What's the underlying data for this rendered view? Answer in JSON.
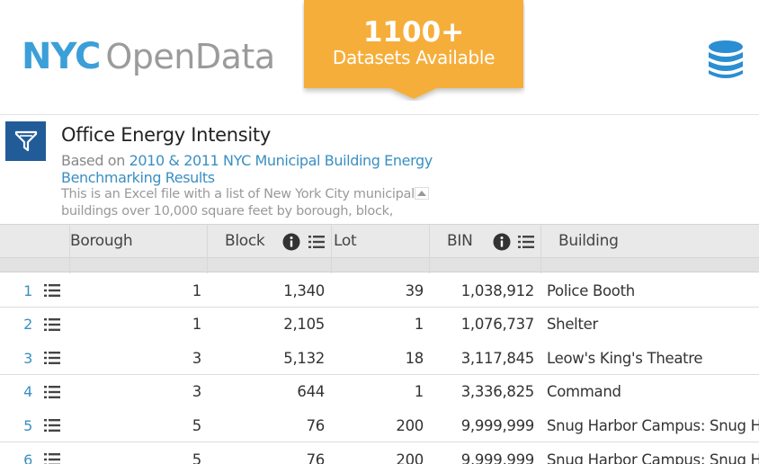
{
  "header": {
    "logo_nyc": "NYC",
    "logo_open": "OpenData",
    "banner_count": "1100+",
    "banner_sub": "Datasets Available",
    "colors": {
      "logo_blue": "#3b9fd8",
      "logo_grey": "#9b9b9b",
      "banner": "#f6ae3b",
      "db_icon": "#2a8ed3"
    },
    "right_icon": "database-icon"
  },
  "dataset": {
    "filter_icon": "filter-icon",
    "title": "Office Energy Intensity",
    "based_prefix": "Based on ",
    "based_link": "2010 & 2011 NYC Municipal Building Energy Benchmarking Results",
    "description": "This is an Excel file with a list of New York City municipal buildings over 10,000 square feet by borough, block, lot,",
    "collapse_icon": "collapse-up-icon"
  },
  "table": {
    "columns": [
      "Borough",
      "Block",
      "Lot",
      "BIN",
      "Building"
    ],
    "header_icons": [
      "info-icon",
      "list-icon"
    ],
    "rows": [
      {
        "index": "1",
        "borough": "1",
        "block": "1,340",
        "lot": "39",
        "bin": "1,038,912",
        "building": "Police Booth"
      },
      {
        "index": "2",
        "borough": "1",
        "block": "2,105",
        "lot": "1",
        "bin": "1,076,737",
        "building": "Shelter"
      },
      {
        "index": "3",
        "borough": "3",
        "block": "5,132",
        "lot": "18",
        "bin": "3,117,845",
        "building": "Leow's King's Theatre"
      },
      {
        "index": "4",
        "borough": "3",
        "block": "644",
        "lot": "1",
        "bin": "3,336,825",
        "building": "Command"
      },
      {
        "index": "5",
        "borough": "5",
        "block": "76",
        "lot": "200",
        "bin": "9,999,999",
        "building": "Snug Harbor Campus: Snug Harb"
      },
      {
        "index": "6",
        "borough": "5",
        "block": "76",
        "lot": "200",
        "bin": "9,999,999",
        "building": "Snug Harbor Campus: Snug Harb"
      }
    ]
  }
}
